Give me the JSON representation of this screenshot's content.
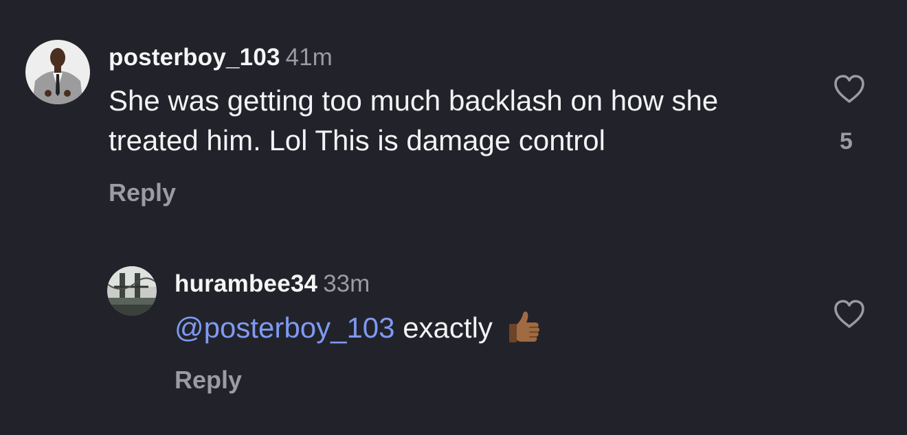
{
  "comments": [
    {
      "username": "posterboy_103",
      "time": "41m",
      "text": "She was getting too much backlash on how she treated him. Lol This is damage control",
      "reply_label": "Reply",
      "like_count": "5",
      "avatar_icon": "avatar-man-in-suit"
    },
    {
      "username": "hurambee34",
      "time": "33m",
      "mention": "@posterboy_103",
      "text": "exactly",
      "emoji": "thumbs-up-medium-dark-skin",
      "reply_label": "Reply",
      "avatar_icon": "avatar-bridge-photo"
    }
  ],
  "colors": {
    "background": "#22232a",
    "text": "#f3f3f5",
    "muted": "#9a9ba3",
    "mention": "#7f9af2"
  }
}
